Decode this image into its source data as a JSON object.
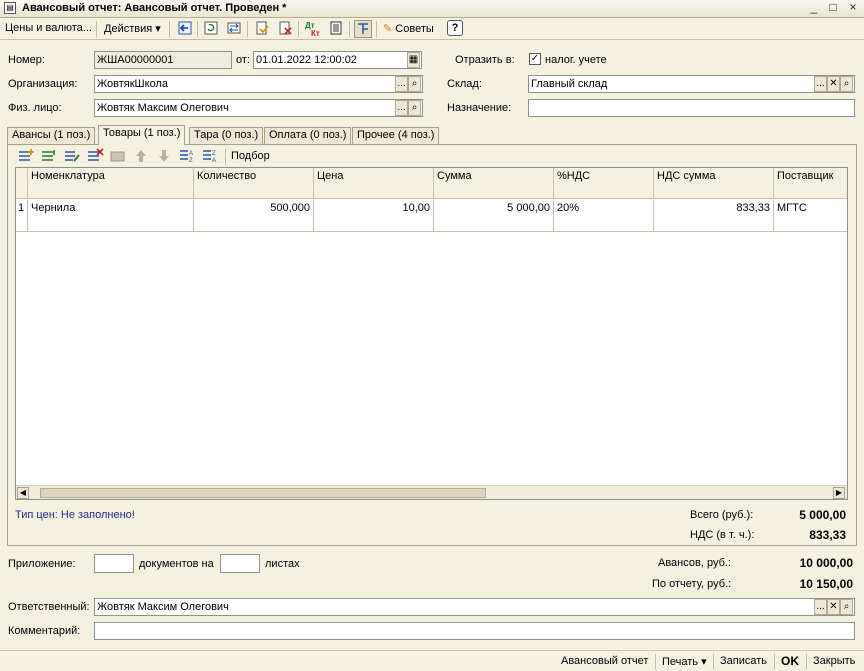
{
  "window": {
    "title": "Авансовый отчет: Авансовый отчет. Проведен *",
    "icon": "document-icon",
    "minimize_glyph": "_",
    "maximize_glyph": "□",
    "close_glyph": "×"
  },
  "toolbar": {
    "prices_label": "Цены и валюта...",
    "actions_label": "Действия",
    "actions_arrow": "▾",
    "dtkt_top": "Дт",
    "dtkt_bottom": "Кт",
    "advice_label": "Советы",
    "help_label": "?"
  },
  "form": {
    "number_label": "Номер:",
    "number_value": "ЖША00000001",
    "from_label": "от:",
    "date_value": "01.01.2022 12:00:02",
    "reflect_label": "Отразить в:",
    "reflect_checked": "✓",
    "reflect_option": "налог. учете",
    "org_label": "Организация:",
    "org_value": "ЖовтякШкола",
    "warehouse_label": "Склад:",
    "warehouse_value": "Главный склад",
    "person_label": "Физ. лицо:",
    "person_value": "Жовтяк Максим Олегович",
    "purpose_label": "Назначение:",
    "purpose_value": ""
  },
  "field_buttons": {
    "select": "...",
    "search": "🔍",
    "clear": "✕"
  },
  "tabs": [
    {
      "label": "Авансы (1 поз.)",
      "active": false
    },
    {
      "label": "Товары (1 поз.)",
      "active": true
    },
    {
      "label": "Тара (0 поз.)",
      "active": false
    },
    {
      "label": "Оплата (0 поз.)",
      "active": false
    },
    {
      "label": "Прочее (4 поз.)",
      "active": false
    }
  ],
  "table_toolbar": {
    "pick_label": "Подбор"
  },
  "table": {
    "columns": [
      "Номенклатура",
      "Количество",
      "Цена",
      "Сумма",
      "%НДС",
      "НДС сумма",
      "Поставщик"
    ],
    "rows": [
      {
        "num": "1",
        "name": "Чернила",
        "qty": "500,000",
        "price": "10,00",
        "sum": "5 000,00",
        "vat_rate": "20%",
        "vat_sum": "833,33",
        "supplier": "МГТС"
      }
    ]
  },
  "summary": {
    "price_type": "Тип цен: Не заполнено!",
    "total_label": "Всего (руб.):",
    "total_value": "5 000,00",
    "vat_label": "НДС (в т. ч.):",
    "vat_value": "833,33"
  },
  "bottom": {
    "attach_label": "Приложение:",
    "docs_label": "документов на",
    "sheets_label": "листах",
    "docs_value": "",
    "sheets_value": "",
    "advances_label": "Авансов, руб.:",
    "advances_value": "10 000,00",
    "report_label": "По отчету, руб.:",
    "report_value": "10 150,00",
    "responsible_label": "Ответственный:",
    "responsible_value": "Жовтяк Максим Олегович",
    "comment_label": "Комментарий:",
    "comment_value": ""
  },
  "statusbar": {
    "report_label": "Авансовый отчет",
    "print_label": "Печать",
    "print_arrow": "▾",
    "save_label": "Записать",
    "ok_label": "OK",
    "close_label": "Закрыть"
  },
  "colors": {
    "background": "#f5f1e1",
    "warning_text": "#1f2c8f"
  }
}
